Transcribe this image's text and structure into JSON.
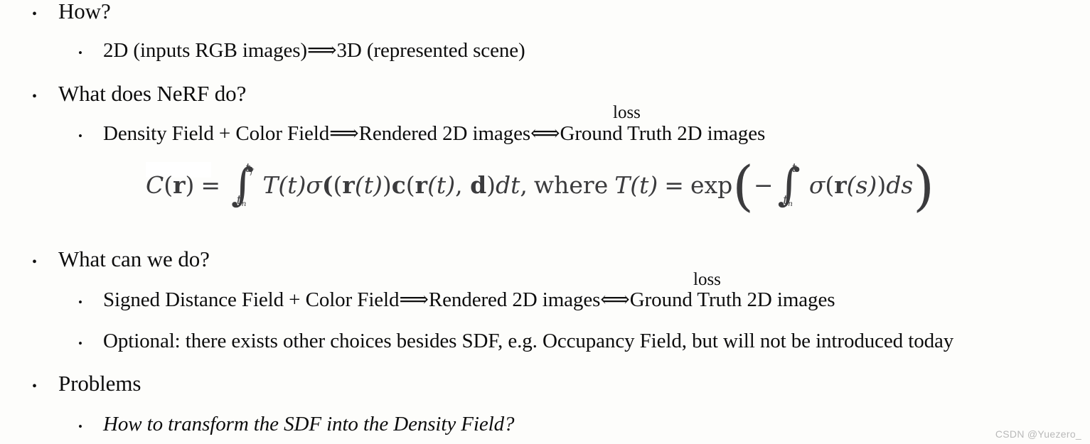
{
  "slide": {
    "background_color": "#fdfdfb",
    "text_color": "#0d0d0d",
    "formula_color": "#3b3b3d",
    "watermark_color": "#b9b9b9",
    "bullet_glyph": "•"
  },
  "outline": [
    {
      "level": 1,
      "id": "how",
      "text": "How?"
    },
    {
      "level": 2,
      "id": "how-sub-1",
      "text": "2D (inputs RGB images) ⟹ 3D (represented scene)",
      "parts": {
        "before": "2D (inputs RGB images) ",
        "arrow": "⟹",
        "after": " 3D (represented scene)"
      }
    },
    {
      "level": 1,
      "id": "what-does-nerf-do",
      "text": "What does NeRF do?"
    },
    {
      "level": 2,
      "id": "nerf-pipeline",
      "text": "Density Field + Color Field ⟹ Rendered 2D images ⟺ Ground Truth 2D images",
      "parts": {
        "before": "Density Field + Color Field ",
        "arrow1": "⟹",
        "middle": " Rendered 2D images ",
        "arrow2": "⟺",
        "after": " Ground Truth 2D images"
      },
      "annotation": "loss"
    },
    {
      "level": 1,
      "id": "what-can-we-do",
      "text": "What can we do?"
    },
    {
      "level": 2,
      "id": "sdf-pipeline",
      "text": "Signed Distance Field + Color Field ⟹ Rendered 2D images ⟺ Ground Truth 2D images",
      "parts": {
        "before": "Signed Distance Field + Color Field ",
        "arrow1": "⟹",
        "middle": " Rendered 2D images ",
        "arrow2": "⟺",
        "after": " Ground Truth 2D images"
      },
      "annotation": "loss"
    },
    {
      "level": 2,
      "id": "optional-note",
      "text": "Optional: there exists other choices besides SDF, e.g. Occupancy Field, but will not be introduced today"
    },
    {
      "level": 1,
      "id": "problems",
      "text": "Problems"
    },
    {
      "level": 2,
      "id": "problem-question",
      "italic": true,
      "text": "How to transform the SDF into the Density Field?"
    }
  ],
  "formula": {
    "id": "nerf-volume-rendering-equation",
    "plain_text": "C(r) = ∫_{t_n}^{t_f} T(t)σ(r(t))c(r(t),d)dt , where T(t) = exp( - ∫_{t_n}^{t} σ(r(s))ds )",
    "tokens": {
      "lhs_C": "C",
      "lhs_r": "r",
      "equals": "=",
      "integral_sym": "∫",
      "limit_lower_1": "t",
      "limit_lower_1_sub": "n",
      "limit_upper_1": "t",
      "limit_upper_1_sub": "f",
      "T_of_t": "T(t)",
      "sigma": "σ",
      "r_of_t": "(r(t))",
      "c_bold": "c",
      "c_args": "(r(t), d)",
      "dt": "dt",
      "comma": ",",
      "where": "where",
      "T_def": "T(t)",
      "equals2": "=",
      "exp": "exp",
      "paren_open": "(",
      "minus": "−",
      "integral_sym_2": "∫",
      "limit_lower_2": "t",
      "limit_lower_2_sub": "n",
      "limit_upper_2": "t",
      "sigma2": "σ",
      "r_of_s": "(r(s))",
      "ds": "ds",
      "paren_close": ")"
    }
  },
  "watermark": {
    "text": "CSDN @Yuezero_"
  }
}
